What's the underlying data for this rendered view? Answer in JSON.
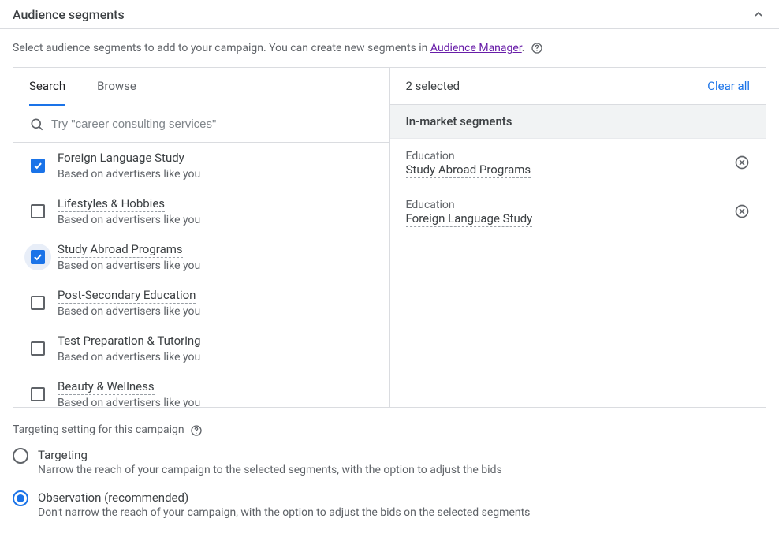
{
  "header": {
    "title": "Audience segments"
  },
  "intro": {
    "prefix": "Select audience segments to add to your campaign. You can create new segments in ",
    "link_text": "Audience Manager",
    "suffix": ". "
  },
  "tabs": {
    "search": "Search",
    "browse": "Browse"
  },
  "search": {
    "placeholder": "Try \"career consulting services\""
  },
  "segments": [
    {
      "title": "Foreign Language Study",
      "sub": "Based on advertisers like you",
      "checked": true,
      "highlighted": false
    },
    {
      "title": "Lifestyles & Hobbies",
      "sub": "Based on advertisers like you",
      "checked": false,
      "highlighted": false
    },
    {
      "title": "Study Abroad Programs",
      "sub": "Based on advertisers like you",
      "checked": true,
      "highlighted": true
    },
    {
      "title": "Post-Secondary Education",
      "sub": "Based on advertisers like you",
      "checked": false,
      "highlighted": false
    },
    {
      "title": "Test Preparation & Tutoring",
      "sub": "Based on advertisers like you",
      "checked": false,
      "highlighted": false
    },
    {
      "title": "Beauty & Wellness",
      "sub": "Based on advertisers like you",
      "checked": false,
      "highlighted": false
    }
  ],
  "right": {
    "selected_count": "2 selected",
    "clear_all": "Clear all",
    "subsection": "In-market segments",
    "selected": [
      {
        "category": "Education",
        "title": "Study Abroad Programs"
      },
      {
        "category": "Education",
        "title": "Foreign Language Study"
      }
    ]
  },
  "targeting": {
    "title": "Targeting setting for this campaign ",
    "options": [
      {
        "label": "Targeting",
        "desc": "Narrow the reach of your campaign to the selected segments, with the option to adjust the bids",
        "selected": false
      },
      {
        "label": "Observation (recommended)",
        "desc": "Don't narrow the reach of your campaign, with the option to adjust the bids on the selected segments",
        "selected": true
      }
    ]
  }
}
